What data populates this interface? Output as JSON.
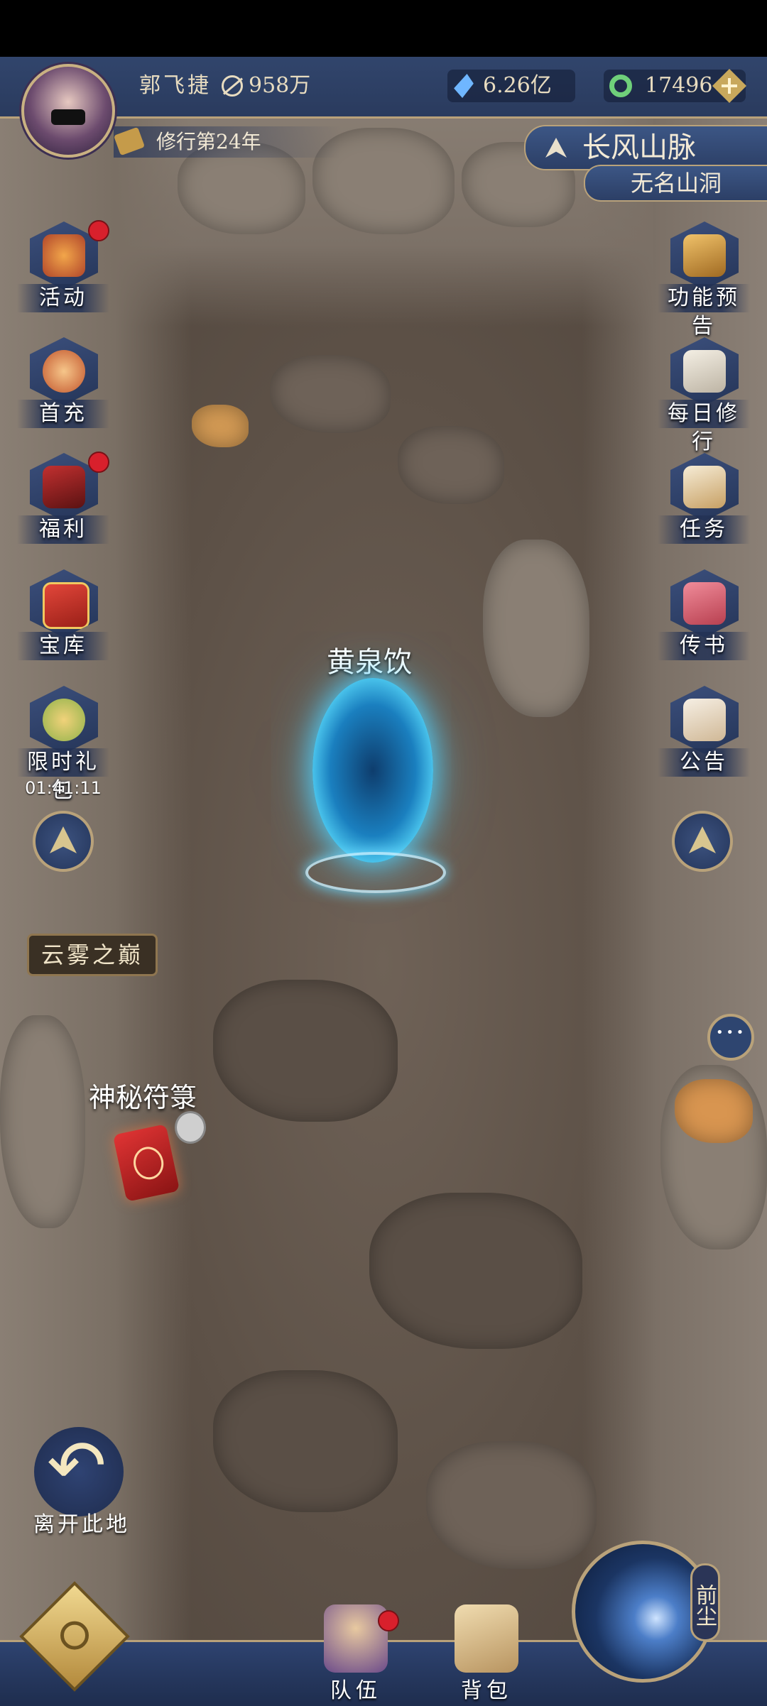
{
  "player": {
    "name": "郭飞捷",
    "power": "958万",
    "spirit_stones": "6.26亿",
    "jade": "17496",
    "cultivation_year": "修行第24年"
  },
  "location": {
    "region": "长风山脉",
    "place": "无名山洞"
  },
  "left_menu": [
    {
      "label": "活动",
      "badge": true
    },
    {
      "label": "首充",
      "badge": false
    },
    {
      "label": "福利",
      "badge": true
    },
    {
      "label": "宝库",
      "badge": false
    },
    {
      "label": "限时礼包",
      "badge": false,
      "timer": "01:41:11"
    }
  ],
  "right_menu": [
    {
      "label": "功能预告"
    },
    {
      "label": "每日修行"
    },
    {
      "label": "任务"
    },
    {
      "label": "传书"
    },
    {
      "label": "公告"
    }
  ],
  "scene": {
    "area_sign": "云雾之巅",
    "portal_name": "黄泉饮",
    "mystic_item": "神秘符箓",
    "leave_label": "离开此地"
  },
  "bottom_menu": [
    {
      "label": "队伍"
    },
    {
      "label": "背包"
    }
  ],
  "qianchen_label": "前尘",
  "colors": {
    "panel": "#2c3f66",
    "gold_border": "#b9a27a",
    "badge_red": "#d8202c",
    "portal_cyan": "#5ee1ff"
  }
}
